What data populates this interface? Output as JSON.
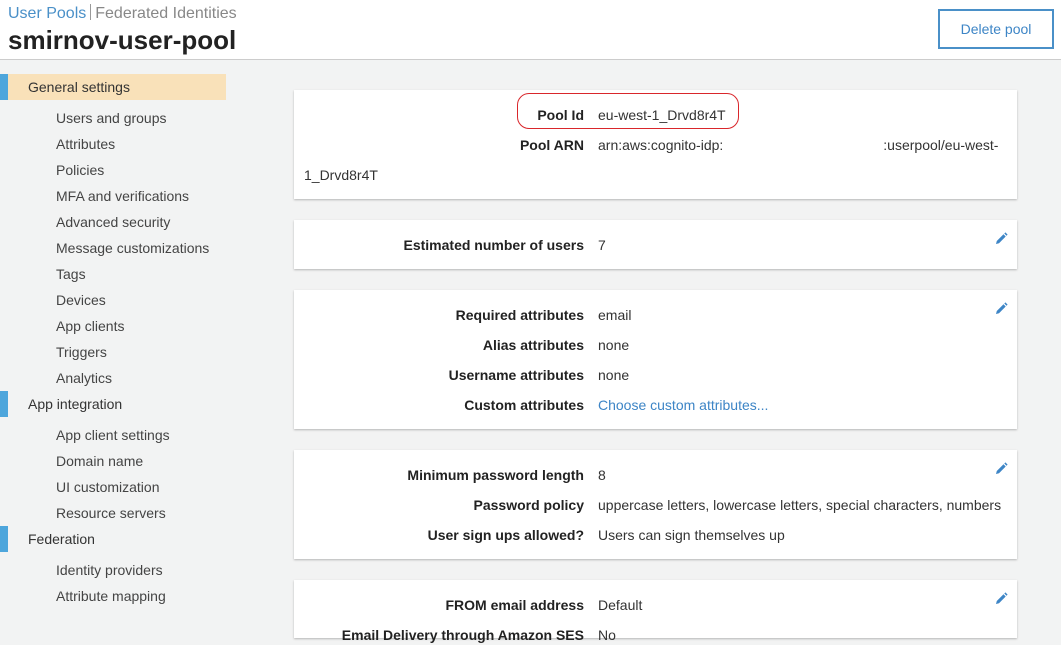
{
  "header": {
    "breadcrumb": {
      "user_pools": "User Pools",
      "federated_identities": "Federated Identities"
    },
    "title": "smirnov-user-pool",
    "delete_label": "Delete pool"
  },
  "sidebar": {
    "general_settings": {
      "label": "General settings",
      "items": [
        "Users and groups",
        "Attributes",
        "Policies",
        "MFA and verifications",
        "Advanced security",
        "Message customizations",
        "Tags",
        "Devices",
        "App clients",
        "Triggers",
        "Analytics"
      ]
    },
    "app_integration": {
      "label": "App integration",
      "items": [
        "App client settings",
        "Domain name",
        "UI customization",
        "Resource servers"
      ]
    },
    "federation": {
      "label": "Federation",
      "items": [
        "Identity providers",
        "Attribute mapping"
      ]
    }
  },
  "pool_info": {
    "pool_id_label": "Pool Id",
    "pool_id": "eu-west-1_Drvd8r4T",
    "arn_label": "Pool ARN",
    "arn_prefix": "arn:aws:cognito-idp:",
    "arn_suffix": ":userpool/eu-west-",
    "arn_wrap": "1_Drvd8r4T"
  },
  "users": {
    "label": "Estimated number of users",
    "value": "7"
  },
  "attributes": [
    {
      "label": "Required attributes",
      "value": "email"
    },
    {
      "label": "Alias attributes",
      "value": "none"
    },
    {
      "label": "Username attributes",
      "value": "none"
    },
    {
      "label": "Custom attributes",
      "value": "Choose custom attributes..."
    }
  ],
  "policies": [
    {
      "label": "Minimum password length",
      "value": "8"
    },
    {
      "label": "Password policy",
      "value": "uppercase letters, lowercase letters, special characters, numbers"
    },
    {
      "label": "User sign ups allowed?",
      "value": "Users can sign themselves up"
    }
  ],
  "messages": [
    {
      "label": "FROM email address",
      "value": "Default"
    },
    {
      "label": "Email Delivery through Amazon SES",
      "value": "No"
    }
  ],
  "colors": {
    "accent": "#4a90c8",
    "active_bg": "#f9e1b9",
    "section_bar": "#4ea6dc",
    "highlight": "#d9262b"
  }
}
